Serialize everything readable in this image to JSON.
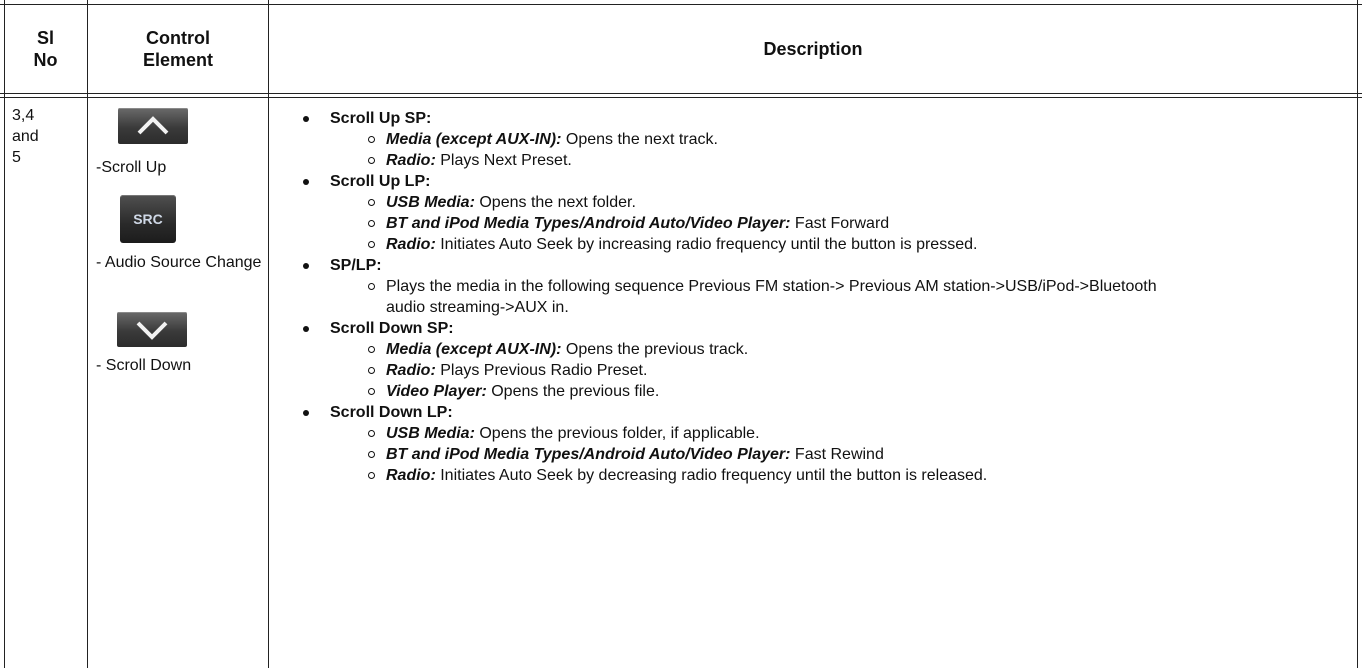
{
  "table": {
    "headers": {
      "sl_no": "Sl No",
      "control_element": "Control Element",
      "description": "Description"
    },
    "row": {
      "sl_no": "3,4 and 5",
      "controls": [
        {
          "icon": "chevron-up-icon",
          "label": "-Scroll Up"
        },
        {
          "icon": "src-button-icon",
          "icon_text": "SRC",
          "label": "- Audio Source Change"
        },
        {
          "icon": "chevron-down-icon",
          "label": "- Scroll Down"
        }
      ],
      "description": [
        {
          "title": "Scroll Up SP:",
          "items": [
            {
              "label": "Media (except AUX-IN):",
              "text": " Opens the next track."
            },
            {
              "label": "Radio:",
              "text": " Plays Next Preset."
            }
          ]
        },
        {
          "title": "Scroll Up LP:",
          "items": [
            {
              "label": "USB Media:",
              "text": " Opens the next folder."
            },
            {
              "label": "BT and iPod Media Types/Android Auto/Video Player:",
              "text": " Fast Forward"
            },
            {
              "label": "Radio:",
              "text": " Initiates Auto Seek by increasing radio frequency until the button is pressed."
            }
          ]
        },
        {
          "title": "SP/LP:",
          "items": [
            {
              "label": "",
              "text": "Plays the media in the following sequence Previous FM station-> Previous AM station->USB/iPod->Bluetooth audio streaming->AUX in."
            }
          ]
        },
        {
          "title": "Scroll Down SP:",
          "items": [
            {
              "label": "Media (except AUX-IN):",
              "text": " Opens the previous track."
            },
            {
              "label": "Radio:",
              "text": " Plays Previous Radio Preset."
            },
            {
              "label": "Video Player:",
              "text": " Opens the previous file."
            }
          ]
        },
        {
          "title": "Scroll Down LP:",
          "items": [
            {
              "label": "USB Media:",
              "text": " Opens the previous folder, if applicable."
            },
            {
              "label": "BT and iPod Media Types/Android Auto/Video Player:",
              "text": " Fast Rewind"
            },
            {
              "label": "Radio:",
              "text": " Initiates Auto Seek by decreasing radio frequency until the button is released."
            }
          ]
        }
      ]
    }
  }
}
